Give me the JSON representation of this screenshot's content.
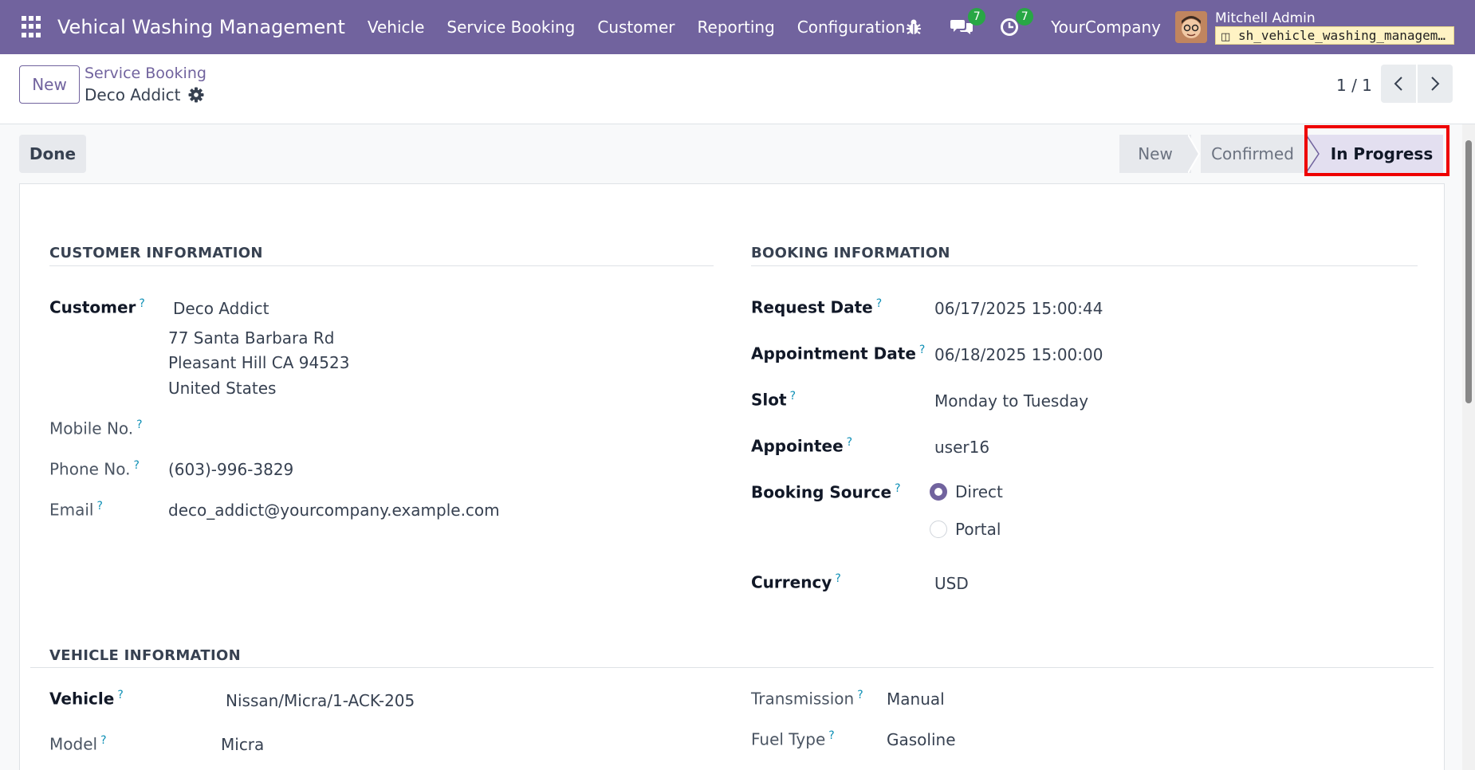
{
  "navbar": {
    "app_title": "Vehical Washing Management",
    "menu": [
      "Vehicle",
      "Service Booking",
      "Customer",
      "Reporting",
      "Configuration"
    ],
    "messages_count": "7",
    "activities_count": "7",
    "company": "YourCompany",
    "user_name": "Mitchell Admin",
    "database": "sh_vehicle_washing_management"
  },
  "control_panel": {
    "new_label": "New",
    "breadcrumb_parent": "Service Booking",
    "breadcrumb_current": "Deco Addict",
    "pager": "1 / 1"
  },
  "statusbar": {
    "done_label": "Done",
    "stages": [
      "New",
      "Confirmed",
      "In Progress"
    ],
    "active_stage": "In Progress"
  },
  "customer_info": {
    "title": "CUSTOMER INFORMATION",
    "customer_label": "Customer",
    "customer_name": "Deco Addict",
    "address_line1": "77 Santa Barbara Rd",
    "address_line2": "Pleasant Hill CA 94523",
    "address_line3": "United States",
    "mobile_label": "Mobile No.",
    "mobile_value": "",
    "phone_label": "Phone No.",
    "phone_value": "(603)-996-3829",
    "email_label": "Email",
    "email_value": "deco_addict@yourcompany.example.com"
  },
  "booking_info": {
    "title": "BOOKING INFORMATION",
    "request_date_label": "Request Date",
    "request_date_value": "06/17/2025 15:00:44",
    "appointment_date_label": "Appointment Date",
    "appointment_date_value": "06/18/2025 15:00:00",
    "slot_label": "Slot",
    "slot_value": "Monday to Tuesday",
    "appointee_label": "Appointee",
    "appointee_value": "user16",
    "booking_source_label": "Booking Source",
    "booking_source_options": [
      "Direct",
      "Portal"
    ],
    "booking_source_selected": "Direct",
    "currency_label": "Currency",
    "currency_value": "USD"
  },
  "vehicle_info": {
    "title": "VEHICLE INFORMATION",
    "vehicle_label": "Vehicle",
    "vehicle_value": "Nissan/Micra/1-ACK-205",
    "model_label": "Model",
    "model_value": "Micra",
    "transmission_label": "Transmission",
    "transmission_value": "Manual",
    "fuel_type_label": "Fuel Type",
    "fuel_type_value": "Gasoline"
  },
  "help_marker": "?",
  "colors": {
    "navbar": "#71639e",
    "accent": "#71639e",
    "badge": "#28a745",
    "help_marker": "#0d8fb5",
    "highlight": "#ee0000"
  }
}
